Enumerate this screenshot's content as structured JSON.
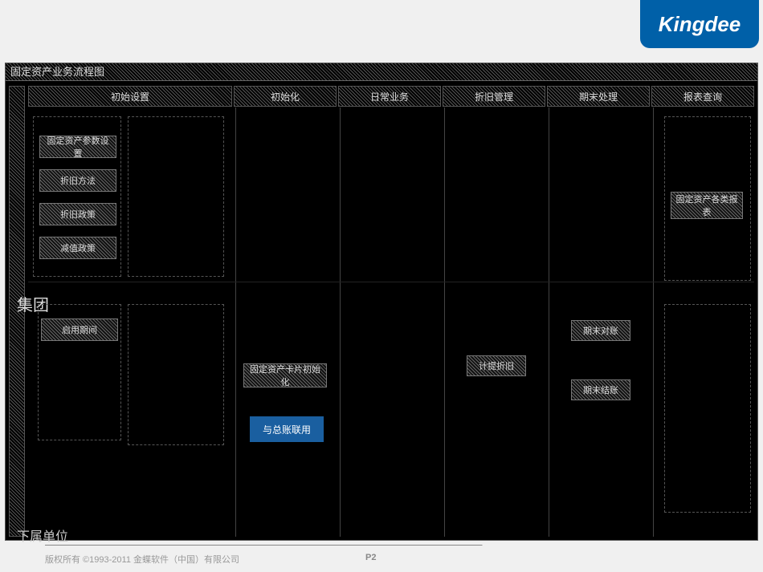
{
  "logo": "Kingdee",
  "title": "固定资产业务流程图",
  "columns": [
    "初始设置",
    "初始化",
    "日常业务",
    "折旧管理",
    "期末处理",
    "报表查询"
  ],
  "lane_label_top": "集团",
  "lane_label_bottom": "下属单位",
  "nodes": {
    "group": {
      "param": "固定资产参数设置",
      "method": "折旧方法",
      "policy": "折旧政策",
      "impair": "减值政策",
      "reports": "固定资产各类报表"
    },
    "unit": {
      "period": "启用期间",
      "cardinit": "固定资产卡片初始化",
      "gl": "与总账联用",
      "depr": "计提折旧",
      "reconcile": "期末对账",
      "close": "期末结账"
    }
  },
  "footer": {
    "copyright": "版权所有  ©1993-2011  金蝶软件（中国）有限公司",
    "page": "P2"
  }
}
